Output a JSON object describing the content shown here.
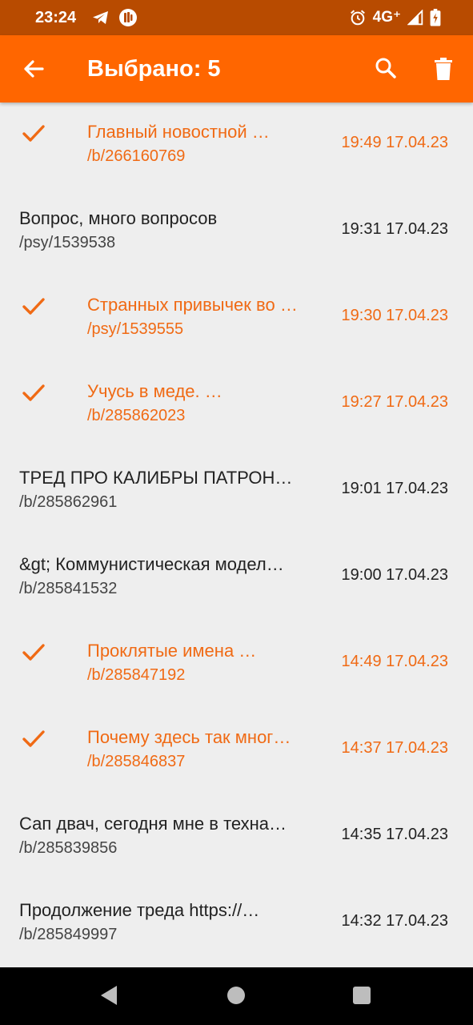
{
  "status_bar": {
    "time": "23:24",
    "network": "4G⁺",
    "icons": [
      "telegram-icon",
      "notification-app-icon",
      "alarm-icon",
      "signal-icon",
      "battery-icon"
    ]
  },
  "app_bar": {
    "title": "Выбрано: 5",
    "icons": [
      "back-arrow-icon",
      "search-icon",
      "trash-icon"
    ],
    "background": "#ff6600"
  },
  "colors": {
    "accent": "#f06a14",
    "status_bar": "#b84b00",
    "list_bg": "#eeeeee"
  },
  "threads": [
    {
      "title": "Главный новостной …",
      "path": "/b/266160769",
      "time": "19:49 17.04.23",
      "selected": true
    },
    {
      "title": "Вопрос, много вопросов",
      "path": "/psy/1539538",
      "time": "19:31 17.04.23",
      "selected": false
    },
    {
      "title": "Странных привычек во …",
      "path": "/psy/1539555",
      "time": "19:30 17.04.23",
      "selected": true
    },
    {
      "title": "Учусь в меде. …",
      "path": "/b/285862023",
      "time": "19:27 17.04.23",
      "selected": true
    },
    {
      "title": "ТРЕД ПРО КАЛИБРЫ ПАТРОН…",
      "path": "/b/285862961",
      "time": "19:01 17.04.23",
      "selected": false
    },
    {
      "title": "&gt; Коммунистическая модел…",
      "path": "/b/285841532",
      "time": "19:00 17.04.23",
      "selected": false
    },
    {
      "title": "Проклятые имена …",
      "path": "/b/285847192",
      "time": "14:49 17.04.23",
      "selected": true
    },
    {
      "title": "Почему здесь так мног…",
      "path": "/b/285846837",
      "time": "14:37 17.04.23",
      "selected": true
    },
    {
      "title": "Сап двач, сегодня мне в техна…",
      "path": "/b/285839856",
      "time": "14:35 17.04.23",
      "selected": false
    },
    {
      "title": "Продолжение треда https://…",
      "path": "/b/285849997",
      "time": "14:32 17.04.23",
      "selected": false
    }
  ],
  "nav_bar": {
    "icons": [
      "nav-back-icon",
      "nav-home-icon",
      "nav-recents-icon"
    ]
  }
}
